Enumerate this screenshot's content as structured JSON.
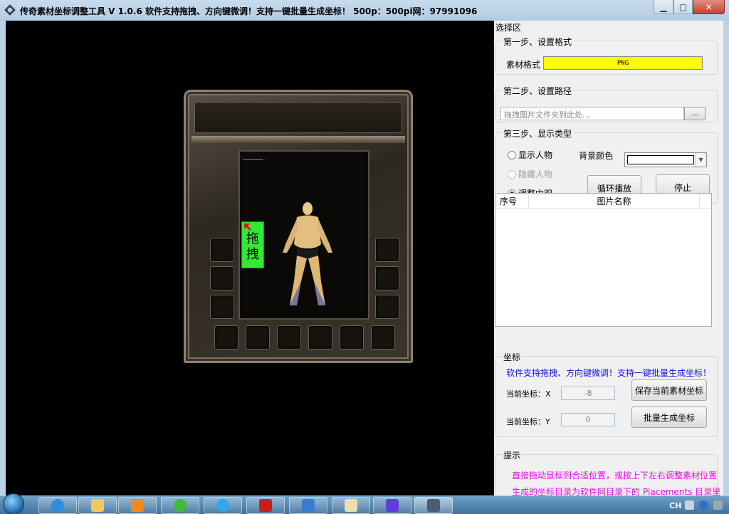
{
  "window": {
    "title": "传奇素材坐标调整工具 V 1.0.6  软件支持拖拽、方向键微调！支持一键批量生成坐标！ 500p：500pi网：97991096"
  },
  "canvas": {
    "drag_label_1": "拖",
    "drag_label_2": "拽"
  },
  "panel": {
    "title": "选择区",
    "step1": {
      "label": "第一步、设置格式",
      "format_label": "素材格式",
      "format_value": "PNG"
    },
    "step2": {
      "label": "第二步、设置路径",
      "path_placeholder": "拖拽图片文件夹到此处...",
      "browse_label": "..."
    },
    "step3": {
      "label": "第三步、显示类型",
      "radio_show": "显示人物",
      "radio_hide": "隐藏人物",
      "radio_inner": "调整内观",
      "bg_color_label": "背景颜色",
      "loop_button": "循环播放",
      "stop_button": "停止"
    },
    "list": {
      "col_index": "序号",
      "col_name": "图片名称"
    },
    "coords": {
      "label": "坐标",
      "hint": "软件支持拖拽、方向键微调！支持一键批量生成坐标！",
      "x_label": "当前坐标：X",
      "x_value": "-8",
      "y_label": "当前坐标：Y",
      "y_value": "0",
      "save_button": "保存当前素材坐标",
      "batch_button": "批量生成坐标"
    },
    "tips": {
      "label": "提示",
      "line1": "直接拖动鼠标到合适位置，或按上下左右调整素材位置",
      "line2": "生成的坐标目录为软件同目录下的 Placements 目录里"
    }
  },
  "taskbar": {
    "lang": "CH"
  },
  "colors": {
    "format_bg": "#ffff00",
    "drag_bg": "#33e933",
    "hint_blue": "#1414e0",
    "tip_magenta": "#e010e0"
  }
}
